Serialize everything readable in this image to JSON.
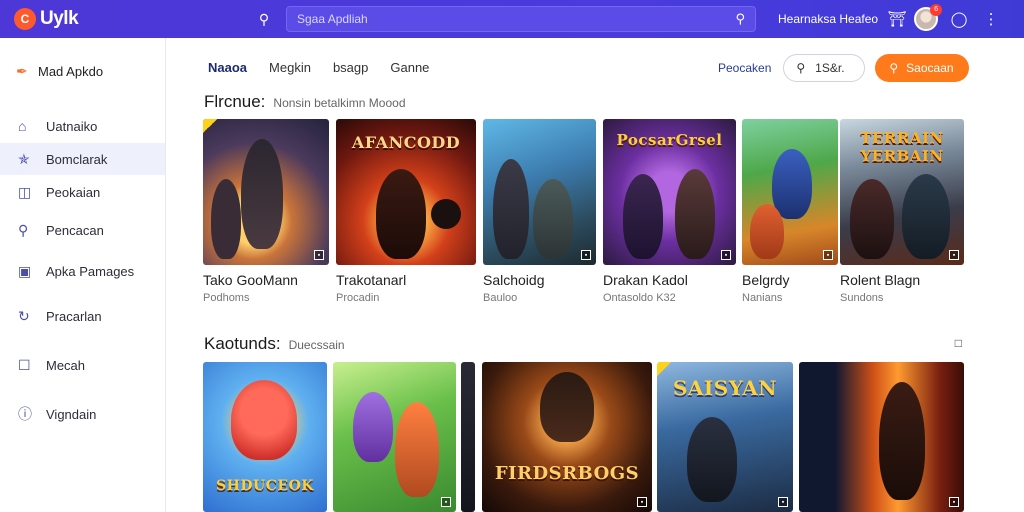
{
  "topbar": {
    "logo_mark": "C",
    "logo_text": "Uylk",
    "search_placeholder": "Sgaa Apdliah",
    "link": "Hearnaksa Heafeo",
    "badge": "6",
    "icons": [
      "search-icon",
      "magnifier-icon",
      "gift-icon",
      "help-icon",
      "more-vertical-icon"
    ]
  },
  "sidebar": {
    "brand": "Mad Apkdo",
    "items": [
      {
        "label": "Uatnaiko",
        "icon": "home-icon"
      },
      {
        "label": "Bomclarak",
        "icon": "compass-icon"
      },
      {
        "label": "Peokaian",
        "icon": "bookmark-icon"
      },
      {
        "label": "Pencacan",
        "icon": "key-icon"
      },
      {
        "label": "Apka Pamages",
        "icon": "apps-icon"
      },
      {
        "label": "Pracarlan",
        "icon": "refresh-icon"
      },
      {
        "label": "Mecah",
        "icon": "chat-icon"
      },
      {
        "label": "Vigndain",
        "icon": "info-icon"
      }
    ]
  },
  "main": {
    "tabs": [
      "Naaoa",
      "Megkin",
      "bsagp",
      "Ganne"
    ],
    "right_link": "Peocaken",
    "filter_pill": "1S&r.",
    "action_button": "Saocaan",
    "sections": [
      {
        "title": "Flrcnue:",
        "subtitle": "Nonsin betalkimn Moood",
        "cards": [
          {
            "title": "Tako GooMann",
            "sub": "Podhoms",
            "art": ""
          },
          {
            "title": "Trakotanarl",
            "sub": "Procadin",
            "art": "AFANCODD"
          },
          {
            "title": "Salchoidg",
            "sub": "Bauloo",
            "art": ""
          },
          {
            "title": "Drakan Kadol",
            "sub": "Ontasoldo K32",
            "art": "PocsarGrsel"
          },
          {
            "title": "Belgrdy",
            "sub": "Nanians",
            "art": ""
          },
          {
            "title": "Rolent Blagn",
            "sub": "Sundons",
            "art": "TERRAIN YERBAIN"
          }
        ]
      },
      {
        "title": "Kaotunds:",
        "subtitle": "Duecssain",
        "cards": [
          {
            "art": "SHDUCEOK"
          },
          {
            "art": ""
          },
          {
            "art": "FIRDSRBOGS"
          },
          {
            "art": "SAISYAN"
          },
          {
            "art": ""
          }
        ]
      }
    ]
  }
}
